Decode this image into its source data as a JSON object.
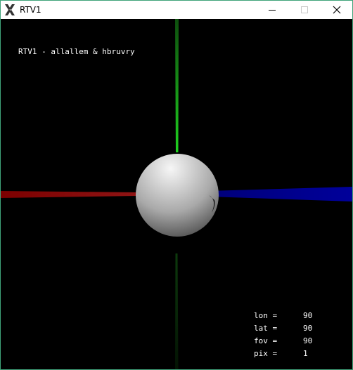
{
  "window": {
    "title": "RTV1",
    "border_color": "#3fa37a"
  },
  "titlebar": {
    "app_icon": "x11-logo-icon",
    "minimize_icon": "minimize-icon",
    "maximize_icon": "maximize-icon",
    "close_icon": "close-icon"
  },
  "scene": {
    "credit": "RTV1 - allallem & hbruvry",
    "background": "#000000",
    "axis_colors": {
      "x": "#8b0000",
      "y": "#00c000",
      "z": "#000090"
    }
  },
  "stats": [
    {
      "label": "lon =",
      "value": "90"
    },
    {
      "label": "lat =",
      "value": "90"
    },
    {
      "label": "fov =",
      "value": "90"
    },
    {
      "label": "pix =",
      "value": "1"
    }
  ]
}
